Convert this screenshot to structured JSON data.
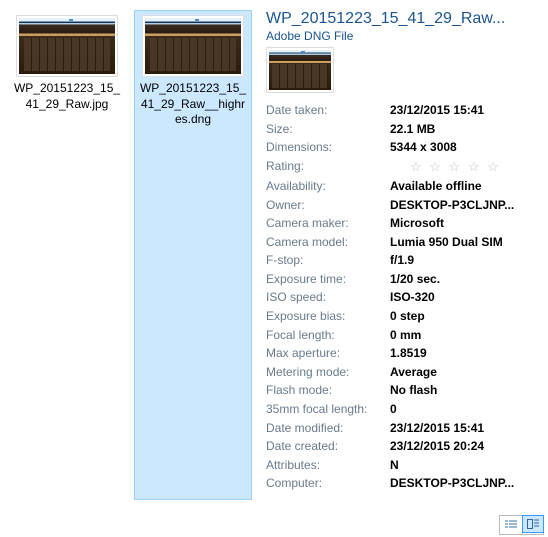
{
  "files": [
    {
      "name": "WP_20151223_15_41_29_Raw.jpg",
      "selected": false
    },
    {
      "name": "WP_20151223_15_41_29_Raw__highres.dng",
      "selected": true
    }
  ],
  "details": {
    "title": "WP_20151223_15_41_29_Raw...",
    "type": "Adobe DNG File",
    "properties": [
      {
        "label": "Date taken:",
        "value": "23/12/2015 15:41"
      },
      {
        "label": "Size:",
        "value": "22.1 MB"
      },
      {
        "label": "Dimensions:",
        "value": "5344 x 3008"
      },
      {
        "label": "Rating:",
        "value": null,
        "rating": true
      },
      {
        "label": "Availability:",
        "value": "Available offline"
      },
      {
        "label": "Owner:",
        "value": "DESKTOP-P3CLJNP..."
      },
      {
        "label": "Camera maker:",
        "value": "Microsoft"
      },
      {
        "label": "Camera model:",
        "value": "Lumia 950 Dual SIM"
      },
      {
        "label": "F-stop:",
        "value": "f/1.9"
      },
      {
        "label": "Exposure time:",
        "value": "1/20 sec."
      },
      {
        "label": "ISO speed:",
        "value": "ISO-320"
      },
      {
        "label": "Exposure bias:",
        "value": "0 step"
      },
      {
        "label": "Focal length:",
        "value": "0 mm"
      },
      {
        "label": "Max aperture:",
        "value": "1.8519"
      },
      {
        "label": "Metering mode:",
        "value": "Average"
      },
      {
        "label": "Flash mode:",
        "value": "No flash"
      },
      {
        "label": "35mm focal length:",
        "value": "0"
      },
      {
        "label": "Date modified:",
        "value": "23/12/2015 15:41"
      },
      {
        "label": "Date created:",
        "value": "23/12/2015 20:24"
      },
      {
        "label": "Attributes:",
        "value": "N"
      },
      {
        "label": "Computer:",
        "value": "DESKTOP-P3CLJNP..."
      }
    ]
  },
  "rating_glyph": "☆ ☆ ☆ ☆ ☆"
}
